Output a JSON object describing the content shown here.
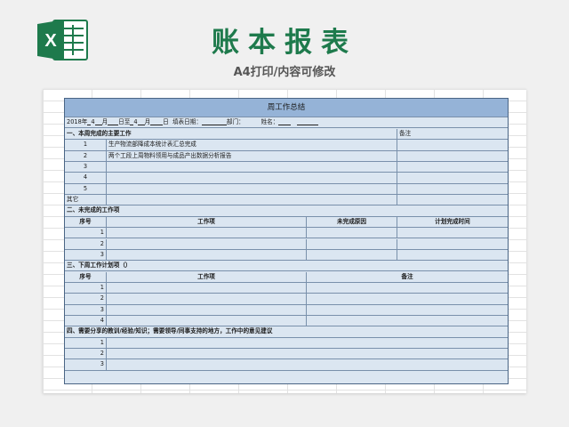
{
  "header": {
    "title": "账本报表",
    "subtitle": "A4打印/内容可修改"
  },
  "form": {
    "title": "周工作总结",
    "info": {
      "year": "2018年",
      "month1": "4",
      "month_label": "月",
      "day_label": "日至",
      "day1": "4",
      "month2_label": "月",
      "day2_label": "日",
      "fill_date": "填表日期：",
      "dept": "部门：",
      "name": "姓名："
    },
    "section1": {
      "title": "一、本周完成的主要工作",
      "note": "备注",
      "rows": [
        {
          "no": "1",
          "text": "生产物流部降成本统计表汇总完成"
        },
        {
          "no": "2",
          "text": "两个工段上周物料领用与成品产出数据分析报告"
        },
        {
          "no": "3",
          "text": ""
        },
        {
          "no": "4",
          "text": ""
        },
        {
          "no": "5",
          "text": ""
        }
      ],
      "other": "其它"
    },
    "section2": {
      "title": "二、未完成的工作项",
      "headers": [
        "序号",
        "工作项",
        "未完成原因",
        "计划完成时间"
      ],
      "rows": [
        "1",
        "2",
        "3"
      ]
    },
    "section3": {
      "title": "三、下周工作计划项（）",
      "headers": [
        "序号",
        "工作项",
        "备注"
      ],
      "rows": [
        "1",
        "2",
        "3",
        "4"
      ]
    },
    "section4": {
      "title": "四、需要分享的教训/经验/知识；需要领导/同事支持的地方，工作中的意见建议",
      "rows": [
        "1",
        "2",
        "3"
      ]
    }
  },
  "colors": {
    "brand_green": "#1e7a4c",
    "title_bar": "#95b3d7",
    "form_fill": "#dbe6f1"
  },
  "icons": [
    "excel-icon"
  ]
}
